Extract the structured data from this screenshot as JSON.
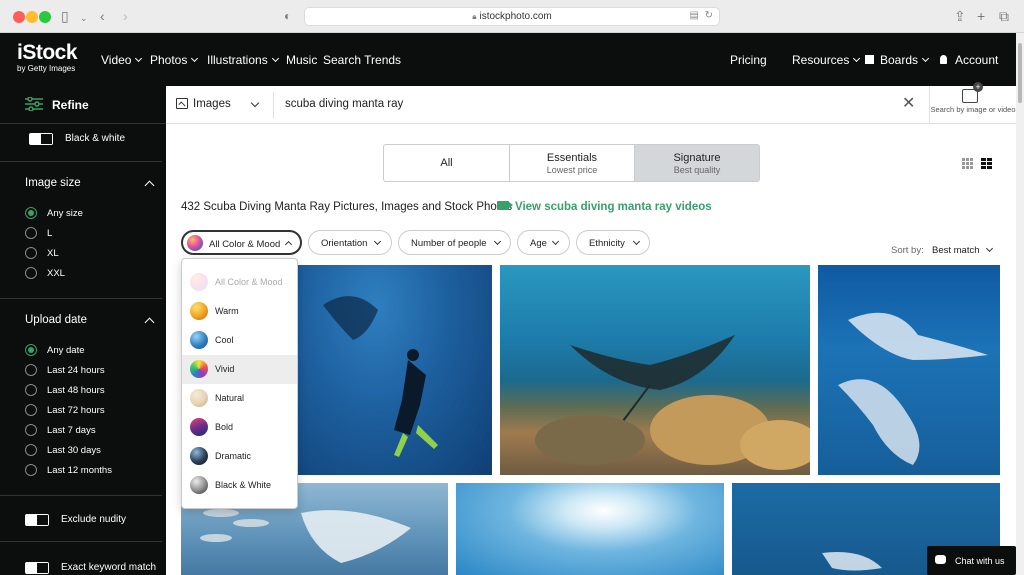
{
  "browser": {
    "url": "istockphoto.com"
  },
  "nav": {
    "logo_main": "iStock",
    "logo_sub": "by Getty Images",
    "video": "Video",
    "photos": "Photos",
    "illustrations": "Illustrations",
    "music": "Music",
    "search_trends": "Search Trends",
    "pricing": "Pricing",
    "resources": "Resources",
    "boards": "Boards",
    "account": "Account"
  },
  "sidebar": {
    "refine": "Refine",
    "black_white": "Black & white",
    "image_size_title": "Image size",
    "image_sizes": [
      "Any size",
      "L",
      "XL",
      "XXL"
    ],
    "upload_date_title": "Upload date",
    "upload_dates": [
      "Any date",
      "Last 24 hours",
      "Last 48 hours",
      "Last 72 hours",
      "Last 7 days",
      "Last 30 days",
      "Last 12 months"
    ],
    "exclude_nudity": "Exclude nudity",
    "exact_keyword": "Exact keyword match"
  },
  "search": {
    "type": "Images",
    "query": "scuba diving manta ray",
    "search_by_image": "Search by image or video"
  },
  "segments": {
    "all": "All",
    "essentials": "Essentials",
    "essentials_sub": "Lowest price",
    "signature": "Signature",
    "signature_sub": "Best quality"
  },
  "results": {
    "title": "432 Scuba Diving Manta Ray Pictures, Images and Stock Photos",
    "video_link": "View scuba diving manta ray videos"
  },
  "filters": {
    "color_mood": "All Color & Mood",
    "orientation": "Orientation",
    "people": "Number of people",
    "age": "Age",
    "ethnicity": "Ethnicity",
    "sort_label": "Sort by:",
    "sort_value": "Best match"
  },
  "mood_options": [
    {
      "label": "All Color & Mood",
      "color": "#e44f9d"
    },
    {
      "label": "Warm",
      "color": "#e59a1f"
    },
    {
      "label": "Cool",
      "color": "#2f7fc0"
    },
    {
      "label": "Vivid",
      "color": "#8e3cc7"
    },
    {
      "label": "Natural",
      "color": "#e8d2b4"
    },
    {
      "label": "Bold",
      "color": "#3b2d6e"
    },
    {
      "label": "Dramatic",
      "color": "#1d2733"
    },
    {
      "label": "Black & White",
      "color": "#6f6f6f"
    }
  ],
  "chat": {
    "label": "Chat with us"
  }
}
